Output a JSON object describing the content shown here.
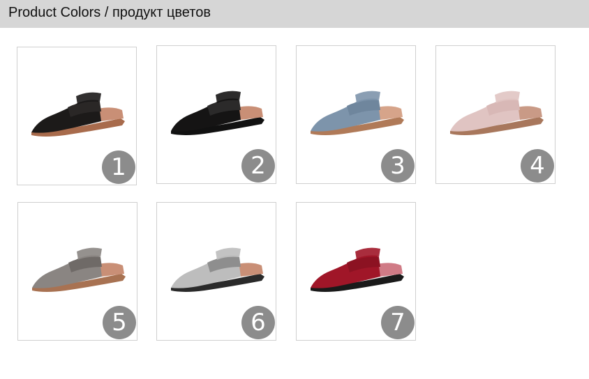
{
  "header": {
    "title": "Product Colors / продукт цветов"
  },
  "products": [
    {
      "number": "1",
      "colors": {
        "body": "#1c1a19",
        "strap": "#2a2726",
        "sole": "#a86b4c",
        "lining": "#c98f76"
      },
      "icon": "shoe-icon"
    },
    {
      "number": "2",
      "colors": {
        "body": "#151414",
        "strap": "#2b2a2a",
        "sole": "#111111",
        "lining": "#c98f76"
      },
      "icon": "shoe-icon"
    },
    {
      "number": "3",
      "colors": {
        "body": "#7d94ab",
        "strap": "#6f869d",
        "sole": "#b07a58",
        "lining": "#d6a48a"
      },
      "icon": "shoe-icon"
    },
    {
      "number": "4",
      "colors": {
        "body": "#e0c4c2",
        "strap": "#d8b8b6",
        "sole": "#a8775c",
        "lining": "#c99a86"
      },
      "icon": "shoe-icon"
    },
    {
      "number": "5",
      "colors": {
        "body": "#8a8582",
        "strap": "#6f6a67",
        "sole": "#a87252",
        "lining": "#c98f76"
      },
      "icon": "shoe-icon"
    },
    {
      "number": "6",
      "colors": {
        "body": "#bdbdbd",
        "strap": "#8e8e8e",
        "sole": "#2a2a2a",
        "lining": "#c98f76"
      },
      "icon": "shoe-icon"
    },
    {
      "number": "7",
      "colors": {
        "body": "#a01628",
        "strap": "#8c1222",
        "sole": "#1a1a1a",
        "lining": "#d07b86"
      },
      "icon": "shoe-icon"
    }
  ]
}
